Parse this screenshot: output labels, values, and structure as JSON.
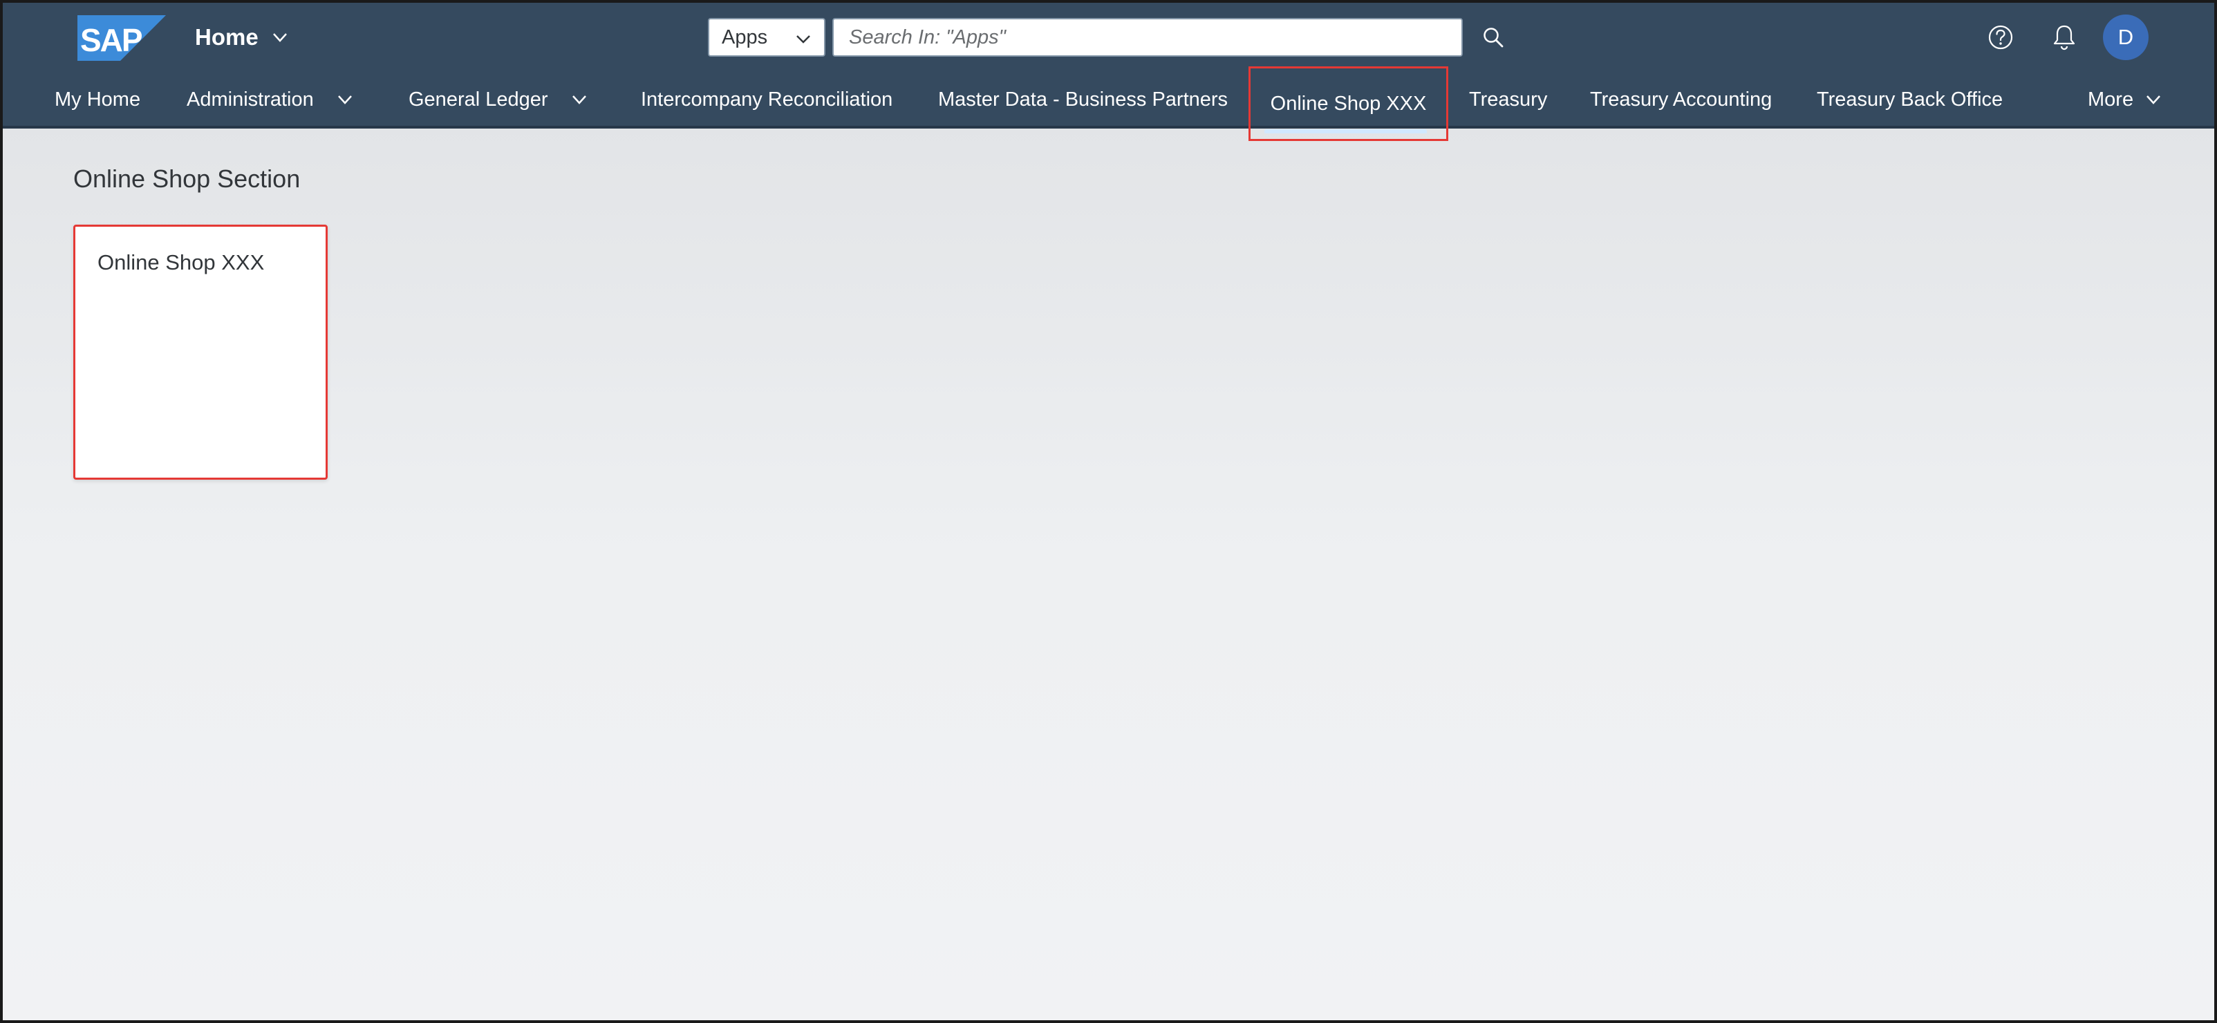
{
  "header": {
    "logo_text": "SAP",
    "home_label": "Home",
    "search_scope": "Apps",
    "search_placeholder": "Search In: \"Apps\"",
    "search_value": "",
    "user_initial": "D",
    "colors": {
      "shell_background": "#354a5f",
      "logo_blue": "#3c8bd9",
      "avatar_background": "#3a6cb8",
      "highlight_outline": "#e53935"
    }
  },
  "nav": {
    "items": [
      {
        "label": "My Home",
        "has_menu": false,
        "selected": false
      },
      {
        "label": "Administration",
        "has_menu": true,
        "selected": false
      },
      {
        "label": "General Ledger",
        "has_menu": true,
        "selected": false
      },
      {
        "label": "Intercompany Reconciliation",
        "has_menu": false,
        "selected": false
      },
      {
        "label": "Master Data - Business Partners",
        "has_menu": false,
        "selected": false
      },
      {
        "label": "Online Shop XXX",
        "has_menu": false,
        "selected": true
      },
      {
        "label": "Treasury",
        "has_menu": false,
        "selected": false
      },
      {
        "label": "Treasury Accounting",
        "has_menu": false,
        "selected": false
      },
      {
        "label": "Treasury Back Office",
        "has_menu": false,
        "selected": false
      }
    ],
    "more_label": "More"
  },
  "content": {
    "section_title": "Online Shop Section",
    "tiles": [
      {
        "title": "Online Shop XXX"
      }
    ]
  },
  "icons": {
    "search": "search-icon",
    "help": "help-icon",
    "notifications": "bell-icon",
    "dropdown": "chevron-down-icon"
  }
}
